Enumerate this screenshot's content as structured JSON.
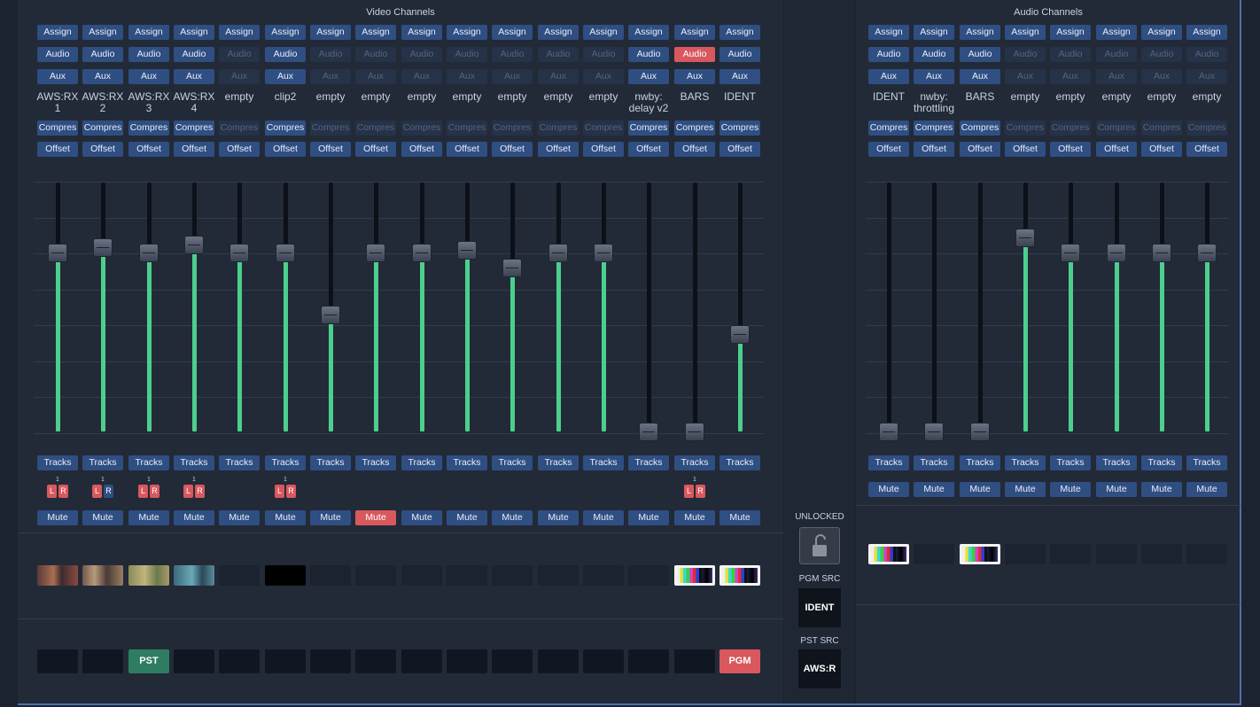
{
  "video": {
    "title": "Video Channels",
    "buttons": {
      "assign": "Assign",
      "audio": "Audio",
      "aux": "Aux",
      "compress": "Compres",
      "offset": "Offset",
      "tracks": "Tracks",
      "mute": "Mute"
    },
    "channels": [
      {
        "name": "AWS:RX 1",
        "audio_on": true,
        "aux_on": true,
        "comp_on": true,
        "level": 0.72,
        "lr": {
          "count": "1",
          "l": "red",
          "r": "red"
        },
        "mute_on": false,
        "thumb": "img1",
        "tally": ""
      },
      {
        "name": "AWS:RX 2",
        "audio_on": true,
        "aux_on": true,
        "comp_on": true,
        "level": 0.74,
        "lr": {
          "count": "1",
          "l": "red",
          "r": "blue"
        },
        "mute_on": false,
        "thumb": "img2",
        "tally": ""
      },
      {
        "name": "AWS:RX 3",
        "audio_on": true,
        "aux_on": true,
        "comp_on": true,
        "level": 0.72,
        "lr": {
          "count": "1",
          "l": "red",
          "r": "red"
        },
        "mute_on": false,
        "thumb": "img3",
        "tally": "PST"
      },
      {
        "name": "AWS:RX 4",
        "audio_on": true,
        "aux_on": true,
        "comp_on": true,
        "level": 0.75,
        "lr": {
          "count": "1",
          "l": "red",
          "r": "red"
        },
        "mute_on": false,
        "thumb": "img4",
        "tally": ""
      },
      {
        "name": "empty",
        "audio_on": false,
        "aux_on": false,
        "comp_on": false,
        "level": 0.72,
        "lr": null,
        "mute_on": false,
        "thumb": "none",
        "tally": ""
      },
      {
        "name": "clip2",
        "audio_on": true,
        "aux_on": true,
        "comp_on": true,
        "level": 0.72,
        "lr": {
          "count": "1",
          "l": "red",
          "r": "red"
        },
        "mute_on": false,
        "thumb": "black",
        "tally": ""
      },
      {
        "name": "empty",
        "audio_on": false,
        "aux_on": false,
        "comp_on": false,
        "level": 0.47,
        "lr": null,
        "mute_on": false,
        "thumb": "none",
        "tally": ""
      },
      {
        "name": "empty",
        "audio_on": false,
        "aux_on": false,
        "comp_on": false,
        "level": 0.72,
        "lr": null,
        "mute_on": true,
        "thumb": "none",
        "tally": ""
      },
      {
        "name": "empty",
        "audio_on": false,
        "aux_on": false,
        "comp_on": false,
        "level": 0.72,
        "lr": null,
        "mute_on": false,
        "thumb": "none",
        "tally": ""
      },
      {
        "name": "empty",
        "audio_on": false,
        "aux_on": false,
        "comp_on": false,
        "level": 0.73,
        "lr": null,
        "mute_on": false,
        "thumb": "none",
        "tally": ""
      },
      {
        "name": "empty",
        "audio_on": false,
        "aux_on": false,
        "comp_on": false,
        "level": 0.66,
        "lr": null,
        "mute_on": false,
        "thumb": "none",
        "tally": ""
      },
      {
        "name": "empty",
        "audio_on": false,
        "aux_on": false,
        "comp_on": false,
        "level": 0.72,
        "lr": null,
        "mute_on": false,
        "thumb": "none",
        "tally": ""
      },
      {
        "name": "empty",
        "audio_on": false,
        "aux_on": false,
        "comp_on": false,
        "level": 0.72,
        "lr": null,
        "mute_on": false,
        "thumb": "none",
        "tally": ""
      },
      {
        "name": "nwby: delay v2",
        "audio_on": true,
        "aux_on": true,
        "comp_on": true,
        "level": 0.0,
        "lr": null,
        "mute_on": false,
        "thumb": "none",
        "tally": ""
      },
      {
        "name": "BARS",
        "audio_on": "red",
        "aux_on": true,
        "comp_on": true,
        "level": 0.0,
        "lr": {
          "count": "1",
          "l": "red",
          "r": "red"
        },
        "mute_on": false,
        "thumb": "bars",
        "tally": ""
      },
      {
        "name": "IDENT",
        "audio_on": true,
        "aux_on": true,
        "comp_on": true,
        "level": 0.39,
        "lr": null,
        "mute_on": false,
        "thumb": "bars",
        "tally": "PGM"
      }
    ]
  },
  "audio": {
    "title": "Audio Channels",
    "channels": [
      {
        "name": "IDENT",
        "audio_on": true,
        "aux_on": true,
        "comp_on": true,
        "level": 0.0,
        "thumb": "bars"
      },
      {
        "name": "nwby: throttling",
        "audio_on": true,
        "aux_on": true,
        "comp_on": true,
        "level": 0.0,
        "thumb": "none"
      },
      {
        "name": "BARS",
        "audio_on": true,
        "aux_on": true,
        "comp_on": true,
        "level": 0.0,
        "thumb": "bars"
      },
      {
        "name": "empty",
        "audio_on": false,
        "aux_on": false,
        "comp_on": false,
        "level": 0.78,
        "thumb": "none"
      },
      {
        "name": "empty",
        "audio_on": false,
        "aux_on": false,
        "comp_on": false,
        "level": 0.72,
        "thumb": "none"
      },
      {
        "name": "empty",
        "audio_on": false,
        "aux_on": false,
        "comp_on": false,
        "level": 0.72,
        "thumb": "none"
      },
      {
        "name": "empty",
        "audio_on": false,
        "aux_on": false,
        "comp_on": false,
        "level": 0.72,
        "thumb": "none"
      },
      {
        "name": "empty",
        "audio_on": false,
        "aux_on": false,
        "comp_on": false,
        "level": 0.72,
        "thumb": "none"
      }
    ]
  },
  "control": {
    "lock_label": "UNLOCKED",
    "pgm_label": "PGM SRC",
    "pgm_value": "IDENT",
    "pst_label": "PST SRC",
    "pst_value": "AWS:R"
  },
  "icons": {
    "lock": "unlocked-padlock-icon"
  },
  "colors": {
    "accent": "#2f4e82",
    "active_red": "#d9585e",
    "level_green": "#4ccf8c",
    "pst_green": "#2e7d62"
  }
}
